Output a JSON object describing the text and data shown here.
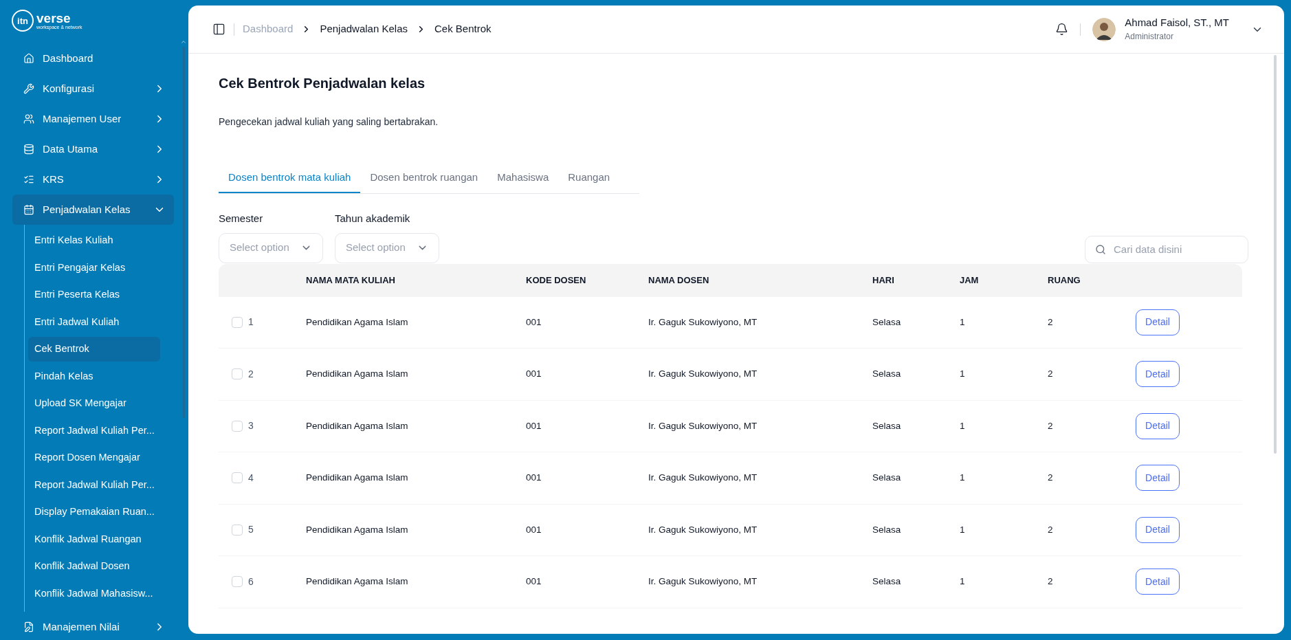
{
  "logo": {
    "mark": "itn",
    "name": "verse",
    "tagline": "workspace & network"
  },
  "sidebar": {
    "items": [
      {
        "label": "Dashboard",
        "kind": "link"
      },
      {
        "label": "Konfigurasi",
        "kind": "group",
        "expanded": false
      },
      {
        "label": "Manajemen User",
        "kind": "group",
        "expanded": false
      },
      {
        "label": "Data Utama",
        "kind": "group",
        "expanded": false
      },
      {
        "label": "KRS",
        "kind": "group",
        "expanded": false
      },
      {
        "label": "Penjadwalan Kelas",
        "kind": "group",
        "expanded": true,
        "children": [
          {
            "label": "Entri Kelas Kuliah",
            "selected": false
          },
          {
            "label": "Entri Pengajar Kelas",
            "selected": false
          },
          {
            "label": "Entri Peserta Kelas",
            "selected": false
          },
          {
            "label": "Entri Jadwal Kuliah",
            "selected": false
          },
          {
            "label": "Cek Bentrok",
            "selected": true
          },
          {
            "label": "Pindah Kelas",
            "selected": false
          },
          {
            "label": "Upload SK Mengajar",
            "selected": false
          },
          {
            "label": "Report Jadwal Kuliah Per...",
            "selected": false
          },
          {
            "label": "Report Dosen Mengajar",
            "selected": false
          },
          {
            "label": "Report Jadwal Kuliah Per...",
            "selected": false
          },
          {
            "label": "Display Pemakaian Ruan...",
            "selected": false
          },
          {
            "label": "Konflik Jadwal Ruangan",
            "selected": false
          },
          {
            "label": "Konflik Jadwal Dosen",
            "selected": false
          },
          {
            "label": "Konflik Jadwal Mahasisw...",
            "selected": false
          }
        ]
      },
      {
        "label": "Manajemen Nilai",
        "kind": "group",
        "expanded": false
      }
    ]
  },
  "header": {
    "breadcrumbs": [
      {
        "label": "Dashboard",
        "kind": "link"
      },
      {
        "label": "Penjadwalan Kelas",
        "kind": "text"
      },
      {
        "label": "Cek Bentrok",
        "kind": "text"
      }
    ],
    "user": {
      "name": "Ahmad Faisol, ST., MT",
      "role": "Administrator"
    }
  },
  "page": {
    "title": "Cek Bentrok Penjadwalan kelas",
    "description": "Pengecekan jadwal kuliah yang saling bertabrakan."
  },
  "tabs": [
    {
      "label": "Dosen bentrok mata kuliah",
      "selected": true
    },
    {
      "label": "Dosen bentrok ruangan",
      "selected": false
    },
    {
      "label": "Mahasiswa",
      "selected": false
    },
    {
      "label": "Ruangan",
      "selected": false
    }
  ],
  "filters": [
    {
      "label": "Semester",
      "placeholder": "Select option"
    },
    {
      "label": "Tahun akademik",
      "placeholder": "Select option"
    }
  ],
  "search": {
    "placeholder": "Cari data disini"
  },
  "table": {
    "columns": [
      "NAMA MATA KULIAH",
      "KODE DOSEN",
      "NAMA DOSEN",
      "HARI",
      "JAM",
      "RUANG"
    ],
    "rows": [
      {
        "checked": false,
        "no": "1",
        "cells": [
          "Pendidikan Agama Islam",
          "001",
          "Ir. Gaguk Sukowiyono, MT",
          "Selasa",
          "1",
          "2"
        ],
        "action": "Detail"
      },
      {
        "checked": false,
        "no": "2",
        "cells": [
          "Pendidikan Agama Islam",
          "001",
          "Ir. Gaguk Sukowiyono, MT",
          "Selasa",
          "1",
          "2"
        ],
        "action": "Detail"
      },
      {
        "checked": false,
        "no": "3",
        "cells": [
          "Pendidikan Agama Islam",
          "001",
          "Ir. Gaguk Sukowiyono, MT",
          "Selasa",
          "1",
          "2"
        ],
        "action": "Detail"
      },
      {
        "checked": false,
        "no": "4",
        "cells": [
          "Pendidikan Agama Islam",
          "001",
          "Ir. Gaguk Sukowiyono, MT",
          "Selasa",
          "1",
          "2"
        ],
        "action": "Detail"
      },
      {
        "checked": false,
        "no": "5",
        "cells": [
          "Pendidikan Agama Islam",
          "001",
          "Ir. Gaguk Sukowiyono, MT",
          "Selasa",
          "1",
          "2"
        ],
        "action": "Detail"
      },
      {
        "checked": false,
        "no": "6",
        "cells": [
          "Pendidikan Agama Islam",
          "001",
          "Ir. Gaguk Sukowiyono, MT",
          "Selasa",
          "1",
          "2"
        ],
        "action": "Detail"
      }
    ]
  }
}
